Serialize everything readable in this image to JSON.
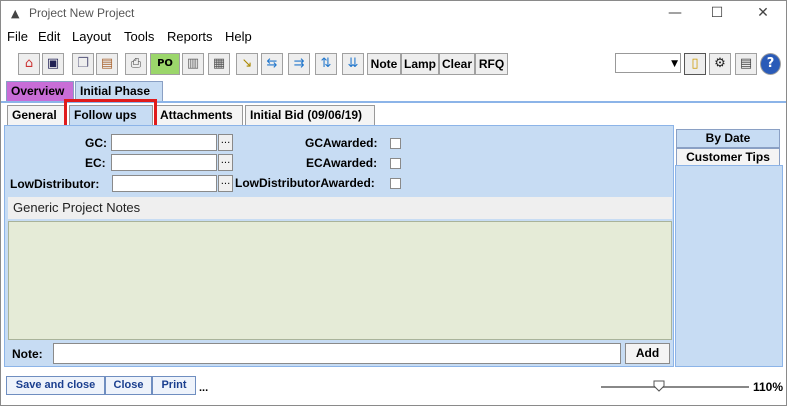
{
  "window": {
    "title": "Project New Project",
    "minimize": "—",
    "maximize": "☐",
    "close": "✕"
  },
  "menu": [
    "File",
    "Edit",
    "Layout",
    "Tools",
    "Reports",
    "Help"
  ],
  "toolbar": {
    "icons": [
      "house-icon",
      "save-icon",
      "copy-icon",
      "paste-icon",
      "print-icon",
      "po-icon",
      "trash-icon",
      "calculator-icon",
      "document-arrow-icon",
      "flow-left-icon",
      "flow-right-icon",
      "flow-up-icon",
      "flow-down-icon"
    ],
    "po_label": "PO",
    "text_buttons": [
      "Note",
      "Lamp",
      "Clear",
      "RFQ"
    ],
    "right_icons": [
      "notepad-icon",
      "machine-icon",
      "document-icon",
      "help-icon"
    ],
    "help_label": "?"
  },
  "tabs_top": [
    {
      "label": "Overview",
      "color": "#c86dd7",
      "active": false
    },
    {
      "label": "Initial Phase",
      "color": "#c7dcf3",
      "active": true
    }
  ],
  "tabs_sub": [
    "General",
    "Follow ups",
    "Attachments",
    "Initial Bid (09/06/19)"
  ],
  "form": {
    "gc_label": "GC:",
    "ec_label": "EC:",
    "lowdist_label": "LowDistributor:",
    "gc_value": "",
    "ec_value": "",
    "lowdist_value": "",
    "browse": "...",
    "gc_awarded": "GCAwarded:",
    "ec_awarded": "ECAwarded:",
    "lowdist_awarded": "LowDistributorAwarded:"
  },
  "notes": {
    "header": "Generic Project Notes",
    "note_label": "Note:",
    "note_value": "",
    "add_label": "Add"
  },
  "side_tabs": [
    "By Date",
    "Customer Tips"
  ],
  "bottom": {
    "buttons": [
      "Save and close",
      "Close",
      "Print"
    ],
    "more": "...",
    "zoom": "110%",
    "zoom_level": 0.4
  },
  "colors": {
    "highlight": "#e01b1b",
    "panel": "#c7dcf3",
    "notes_bg": "#e5ebd7"
  }
}
